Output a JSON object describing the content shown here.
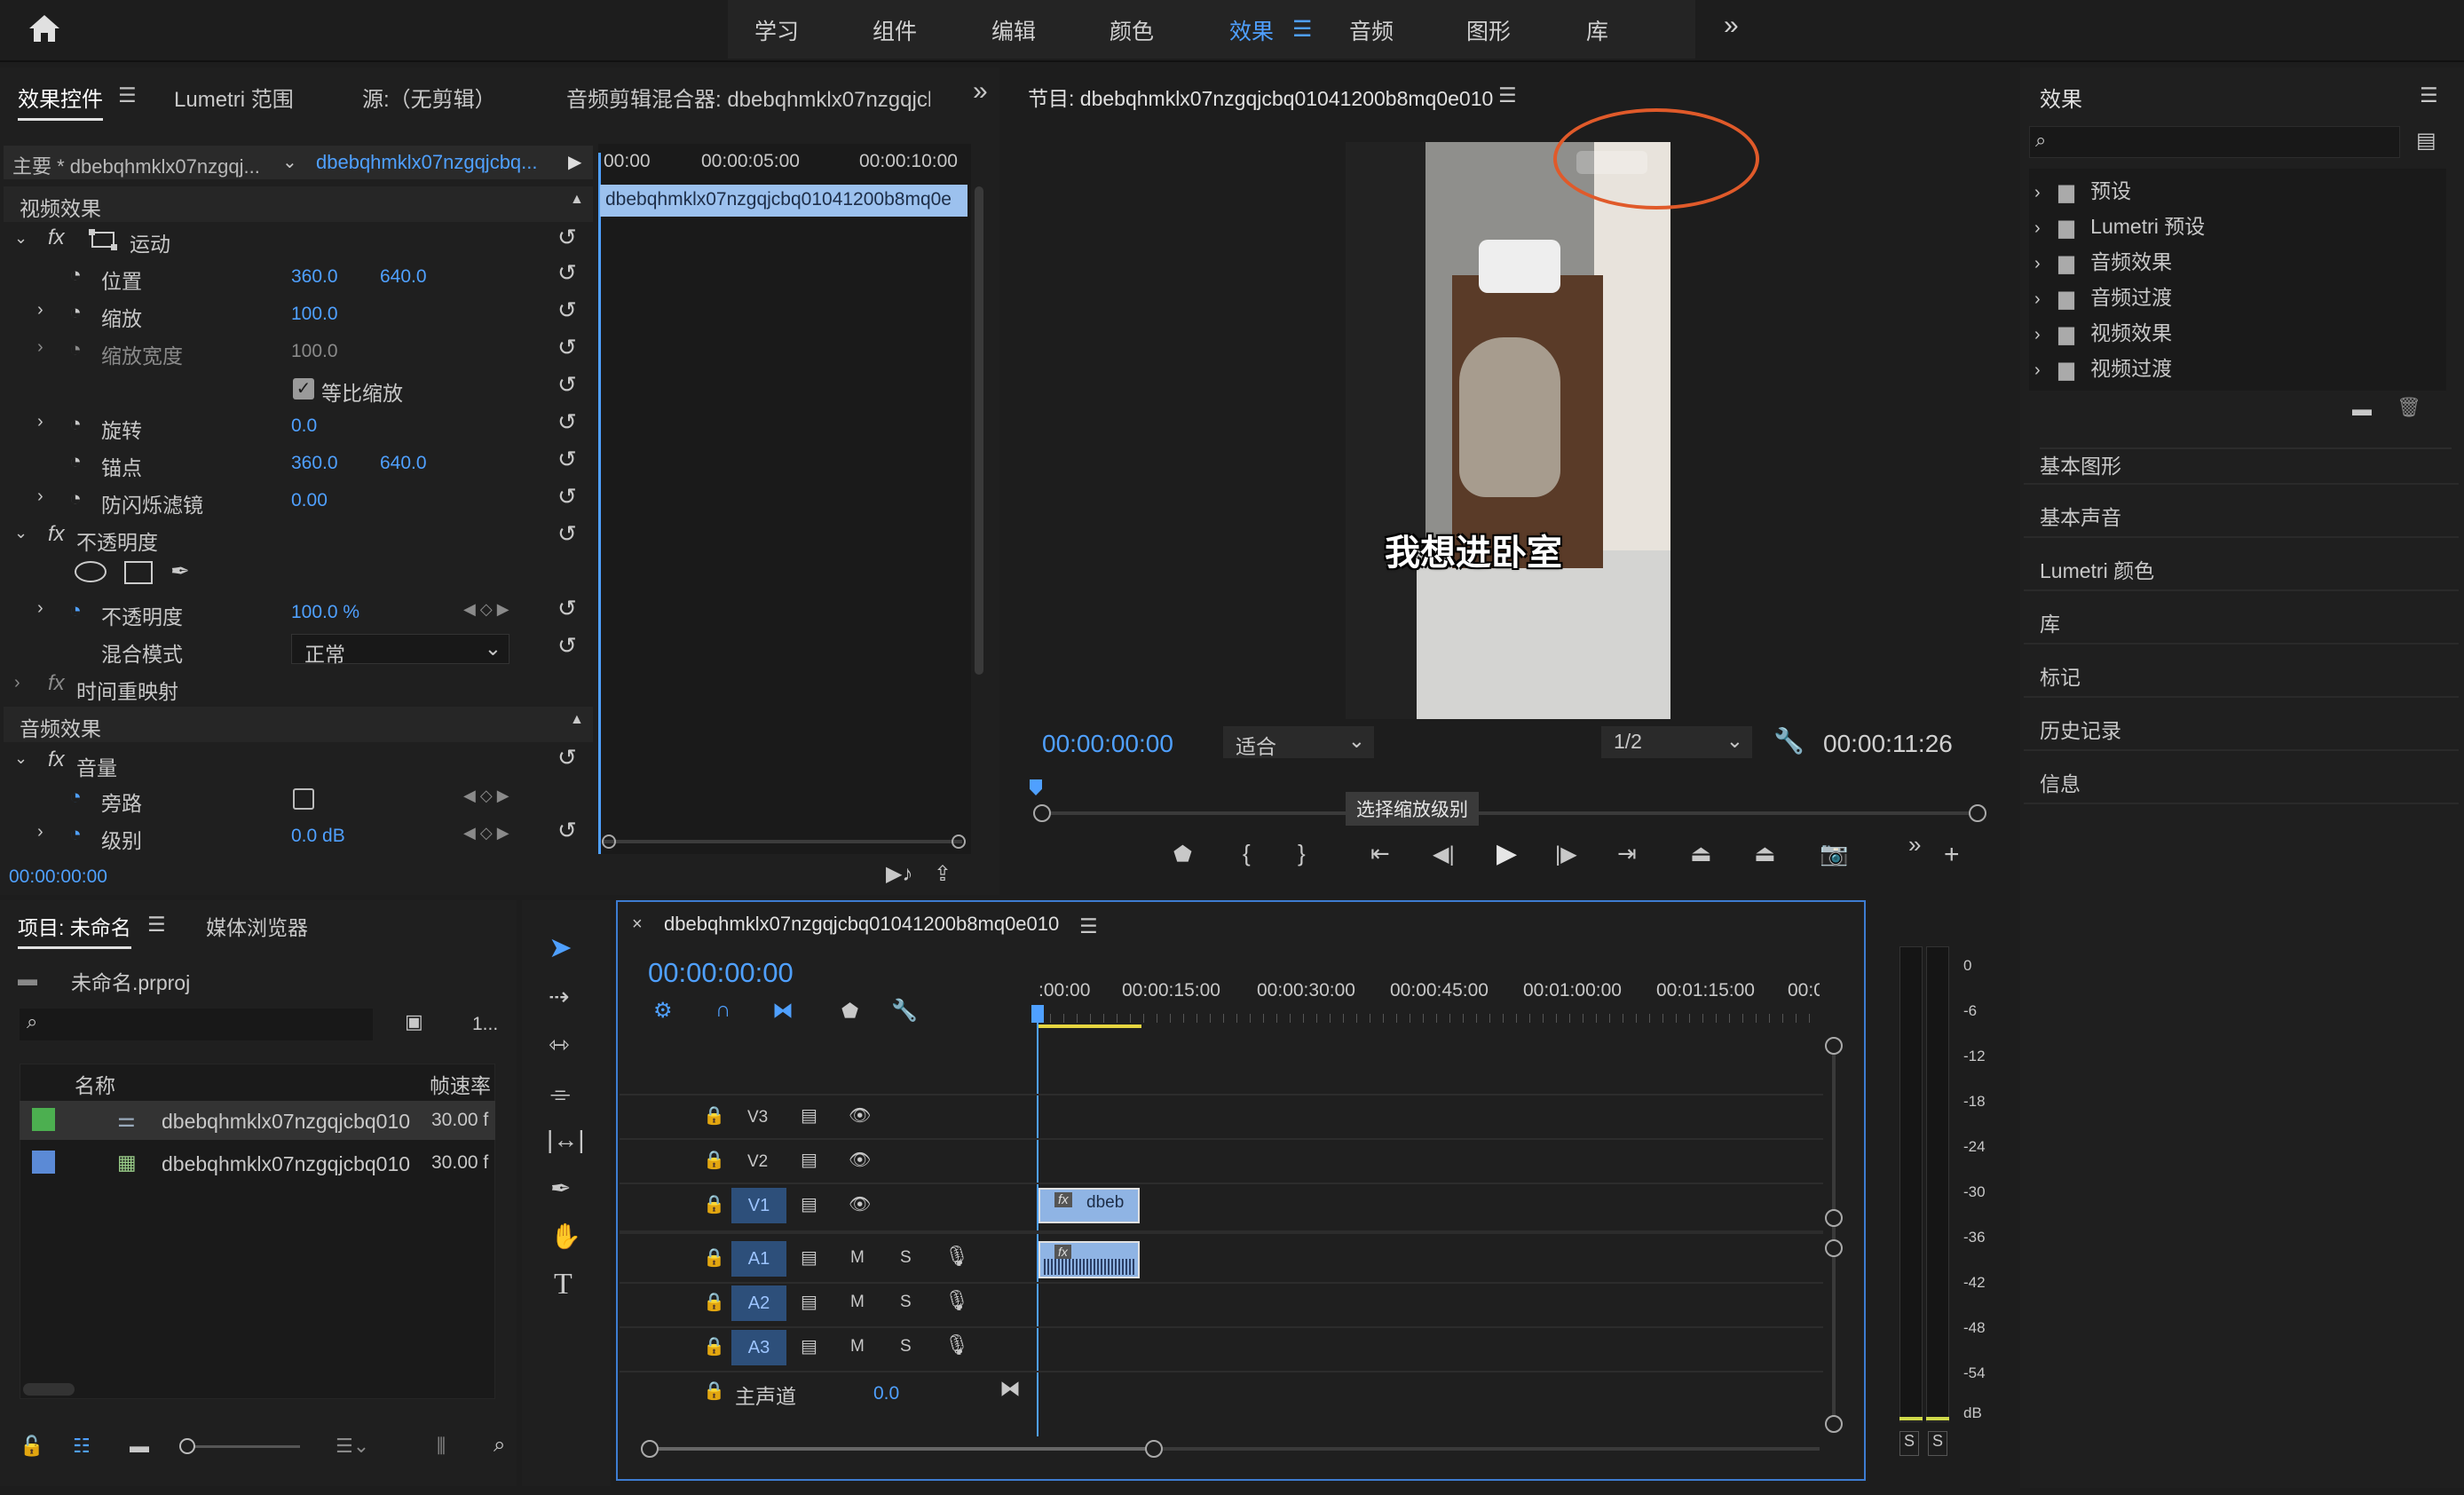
{
  "workspaces": [
    "学习",
    "组件",
    "编辑",
    "颜色",
    "效果",
    "音频",
    "图形",
    "库"
  ],
  "active_workspace": "效果",
  "effect_controls": {
    "tabs": [
      "效果控件",
      "Lumetri 范围",
      "源:（无剪辑）",
      "音频剪辑混合器: dbebqhmklx07nzgqjcbc"
    ],
    "master": "主要 * dbebqhmklx07nzgqj...",
    "clip": "dbebqhmklx07nzgqjcbq...",
    "ruler": [
      "00:00",
      "00:00:05:00",
      "00:00:10:00"
    ],
    "clip_bar": "dbebqhmklx07nzgqjcbq01041200b8mq0e",
    "video_effects": "视频效果",
    "motion": "运动",
    "position": {
      "label": "位置",
      "x": "360.0",
      "y": "640.0"
    },
    "scale": {
      "label": "缩放",
      "value": "100.0"
    },
    "scale_width": {
      "label": "缩放宽度",
      "value": "100.0"
    },
    "uniform_scale": "等比缩放",
    "rotation": {
      "label": "旋转",
      "value": "0.0"
    },
    "anchor": {
      "label": "锚点",
      "x": "360.0",
      "y": "640.0"
    },
    "anti_flicker": {
      "label": "防闪烁滤镜",
      "value": "0.00"
    },
    "opacity_group": "不透明度",
    "opacity": {
      "label": "不透明度",
      "value": "100.0 %"
    },
    "blend_mode": {
      "label": "混合模式",
      "value": "正常"
    },
    "time_remap": "时间重映射",
    "audio_effects": "音频效果",
    "volume": "音量",
    "bypass": "旁路",
    "level": {
      "label": "级别",
      "value": "0.0 dB"
    },
    "timecode": "00:00:00:00"
  },
  "program": {
    "title": "节目: dbebqhmklx07nzgqjcbq01041200b8mq0e010",
    "subtitle": "我想进卧室",
    "timecode": "00:00:00:00",
    "fit": "适合",
    "resolution": "1/2",
    "duration": "00:00:11:26",
    "tooltip": "选择缩放级别"
  },
  "effects_panel": {
    "title": "效果",
    "folders": [
      "预设",
      "Lumetri 预设",
      "音频效果",
      "音频过渡",
      "视频效果",
      "视频过渡"
    ],
    "sections": [
      "基本图形",
      "基本声音",
      "Lumetri 颜色",
      "库",
      "标记",
      "历史记录",
      "信息"
    ]
  },
  "project": {
    "tabs": [
      "项目: 未命名",
      "媒体浏览器"
    ],
    "file": "未命名.prproj",
    "count": "1...",
    "col_name": "名称",
    "col_fps": "帧速率",
    "items": [
      {
        "name": "dbebqhmklx07nzgqjcbq010",
        "fps": "30.00 f",
        "color": "#4caf50"
      },
      {
        "name": "dbebqhmklx07nzgqjcbq010",
        "fps": "30.00 f",
        "color": "#5b8ad6"
      }
    ]
  },
  "timeline": {
    "title": "dbebqhmklx07nzgqjcbq01041200b8mq0e010",
    "timecode": "00:00:00:00",
    "ruler": [
      ":00:00",
      "00:00:15:00",
      "00:00:30:00",
      "00:00:45:00",
      "00:01:00:00",
      "00:01:15:00",
      "00:0"
    ],
    "video_tracks": [
      "V3",
      "V2",
      "V1"
    ],
    "audio_tracks": [
      "A1",
      "A2",
      "A3"
    ],
    "master": "主声道",
    "master_value": "0.0",
    "clip_label": "dbeb",
    "m": "M",
    "s": "S"
  },
  "meter": {
    "ticks": [
      "0",
      "-6",
      "-12",
      "-18",
      "-24",
      "-30",
      "-36",
      "-42",
      "-48",
      "-54",
      "dB"
    ],
    "solo": [
      "S",
      "S"
    ]
  }
}
